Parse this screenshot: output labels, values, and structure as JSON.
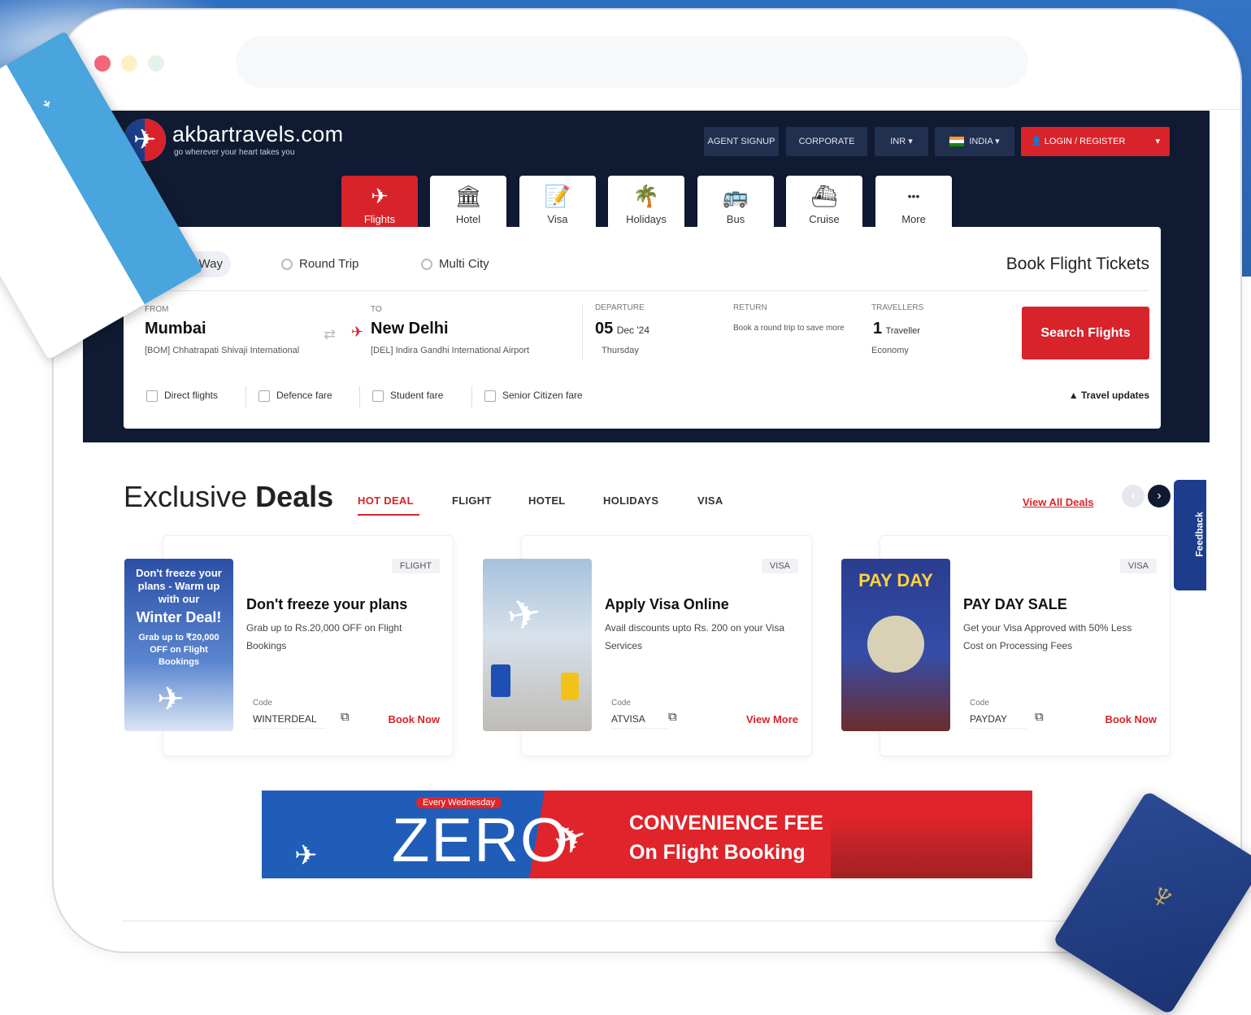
{
  "site": {
    "logo_text": "akbartravels.com",
    "logo_tagline": "go wherever your heart takes you"
  },
  "header": {
    "btn_1": "AGENT SIGNUP",
    "btn_2": "CORPORATE",
    "currency": "INR",
    "country": "INDIA",
    "login": "LOGIN / REGISTER"
  },
  "services": [
    {
      "label": "Flights",
      "icon": "flight-icon"
    },
    {
      "label": "Hotel",
      "icon": "hotel-icon"
    },
    {
      "label": "Visa",
      "icon": "visa-icon"
    },
    {
      "label": "Holidays",
      "icon": "holidays-icon"
    },
    {
      "label": "Bus",
      "icon": "bus-icon"
    },
    {
      "label": "Cruise",
      "icon": "cruise-icon"
    },
    {
      "label": "More",
      "icon": "more-icon"
    }
  ],
  "search": {
    "trip_types": [
      "One Way",
      "Round Trip",
      "Multi City"
    ],
    "heading": "Book Flight Tickets",
    "from_label": "FROM",
    "from_city": "Mumbai",
    "from_sub": "[BOM] Chhatrapati Shivaji International",
    "to_label": "TO",
    "to_city": "New Delhi",
    "to_sub": "[DEL] Indira Gandhi International Airport",
    "depart_label": "DEPARTURE",
    "depart_day": "05",
    "depart_month": "Dec '24",
    "depart_weekday": "Thursday",
    "return_label": "RETURN",
    "return_text": "Book a round trip to save more",
    "travellers_label": "TRAVELLERS",
    "travellers_count": "1",
    "travellers_unit": "Traveller",
    "travellers_class": "Economy",
    "search_button": "Search Flights",
    "fare_options": [
      "Direct flights",
      "Defence fare",
      "Student fare",
      "Senior Citizen fare"
    ],
    "travel_update": "Travel updates"
  },
  "deals": {
    "title_light": "Exclusive",
    "title_bold": "Deals",
    "tabs": [
      "HOT DEAL",
      "FLIGHT",
      "HOTEL",
      "HOLIDAYS",
      "VISA"
    ],
    "view_all": "View All Deals",
    "cards": [
      {
        "badge": "FLIGHT",
        "title": "Don't freeze your plans",
        "desc": "Grab up to Rs.20,000 OFF on Flight Bookings",
        "code_label": "Code",
        "code": "WINTERDEAL",
        "link": "Book Now",
        "img_top": "Don't freeze your plans - Warm up with our",
        "img_big": "Winter Deal!",
        "img_sub": "Grab up to ₹20,000 OFF on Flight Bookings"
      },
      {
        "badge": "VISA",
        "title": "Apply Visa Online",
        "desc": "Avail discounts upto Rs. 200 on your Visa Services",
        "code_label": "Code",
        "code": "ATVISA",
        "link": "View More"
      },
      {
        "badge": "VISA",
        "title": "PAY DAY SALE",
        "desc": "Get your Visa Approved with 50% Less Cost on Processing Fees",
        "code_label": "Code",
        "code": "PAYDAY",
        "link": "Book Now",
        "img_title": "PAY DAY"
      }
    ]
  },
  "promo": {
    "every": "Every Wednesday",
    "zero": "ZERO",
    "line1": "CONVENIENCE FEE",
    "line2": "On Flight Booking"
  },
  "feedback": "Feedback",
  "colors": {
    "brand_red": "#d8232a",
    "header_navy": "#101b33",
    "brand_blue": "#1d3d8c"
  }
}
